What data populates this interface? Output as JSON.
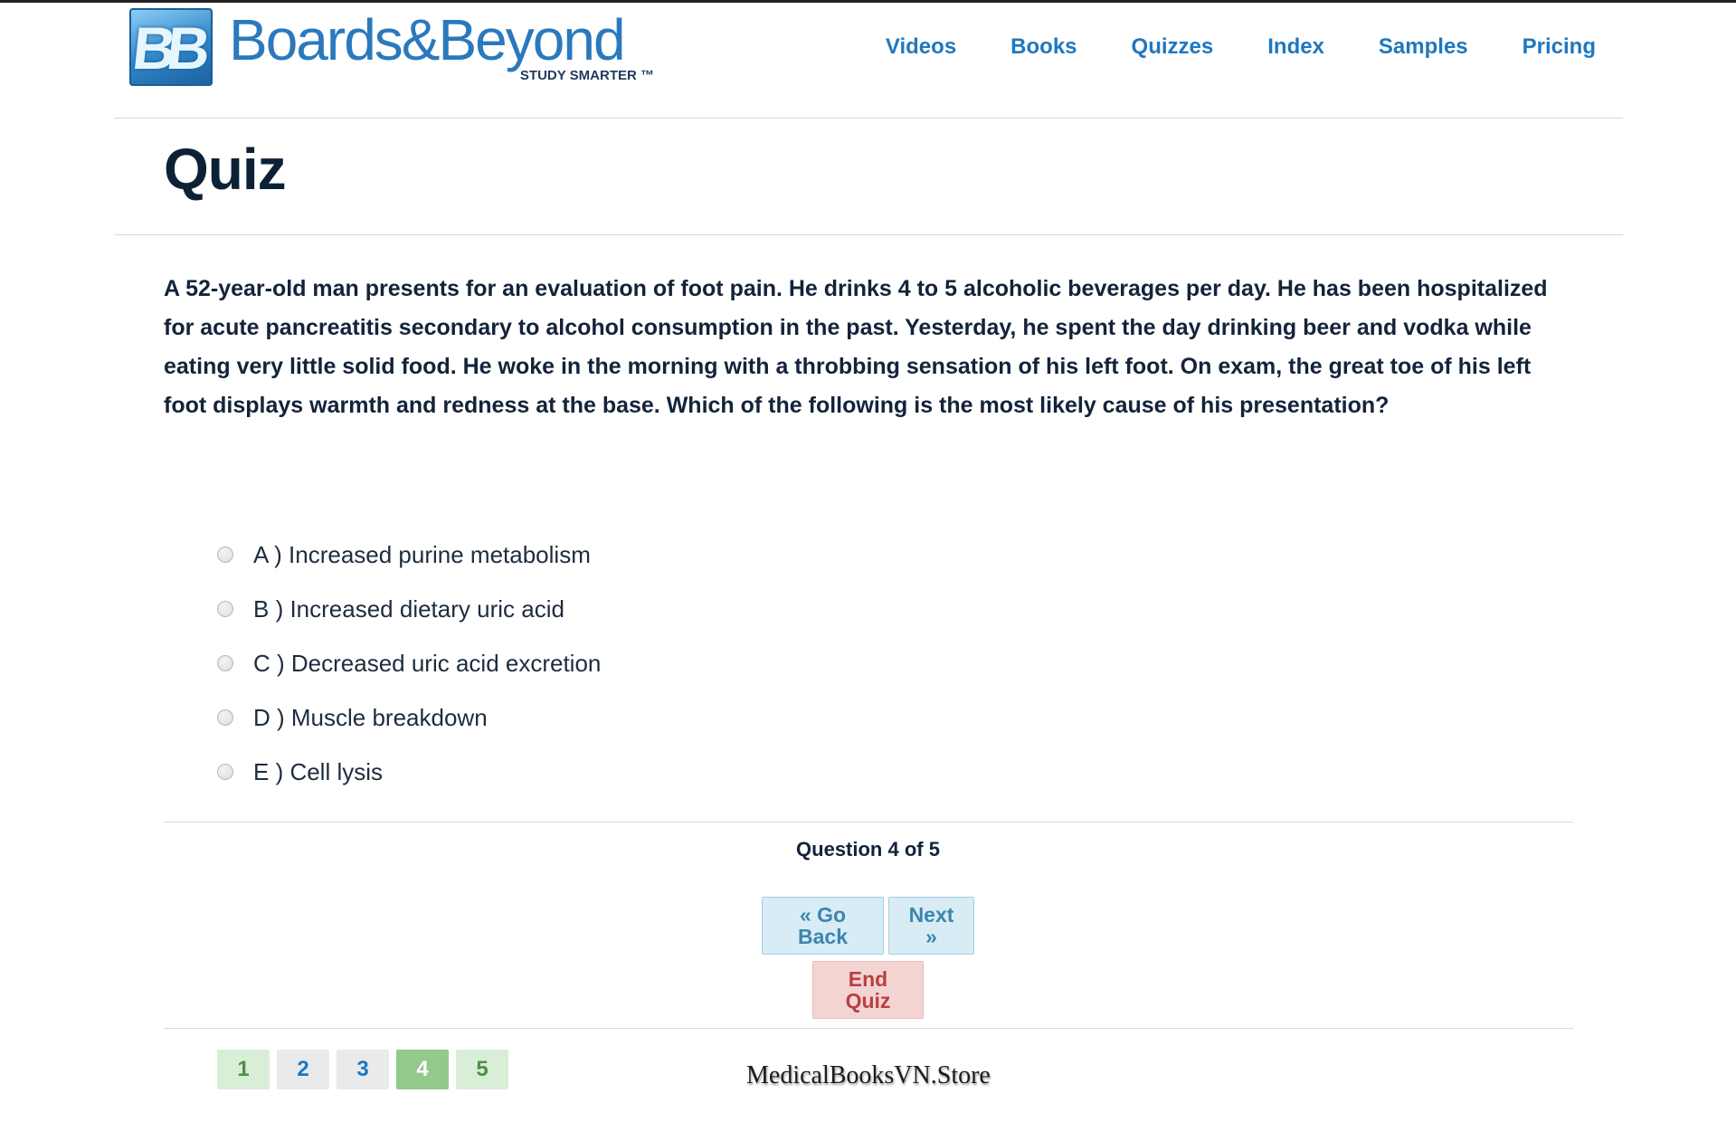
{
  "header": {
    "logo_mark": "BB",
    "logo_text": "Boards&Beyond",
    "logo_tagline": "STUDY SMARTER ™",
    "nav": [
      "Videos",
      "Books",
      "Quizzes",
      "Index",
      "Samples",
      "Pricing"
    ]
  },
  "page": {
    "title": "Quiz"
  },
  "question": {
    "text": "A 52-year-old man presents for an evaluation of foot pain. He drinks 4 to 5 alcoholic beverages per day. He has been hospitalized for acute pancreatitis secondary to alcohol consumption in the past. Yesterday, he spent the day drinking beer and vodka while eating very little solid food. He woke in the morning with a throbbing sensation of his left foot. On exam, the great toe of his left foot displays warmth and redness at the base. Which of the following is the most likely cause of his presentation?",
    "choices": [
      "A ) Increased purine metabolism",
      "B ) Increased dietary uric acid",
      "C ) Decreased uric acid excretion",
      "D ) Muscle breakdown",
      "E ) Cell lysis"
    ]
  },
  "navigation": {
    "progress": "Question 4 of 5",
    "back_label": "« Go Back",
    "next_label": "Next »",
    "end_label": "End Quiz",
    "pages": [
      "1",
      "2",
      "3",
      "4",
      "5"
    ]
  },
  "watermark": "MedicalBooksVN.Store",
  "colors": {
    "brand_blue": "#1f77bf",
    "title_navy": "#0d2136",
    "end_red": "#b9403f",
    "page_current_green": "#93c98b"
  }
}
